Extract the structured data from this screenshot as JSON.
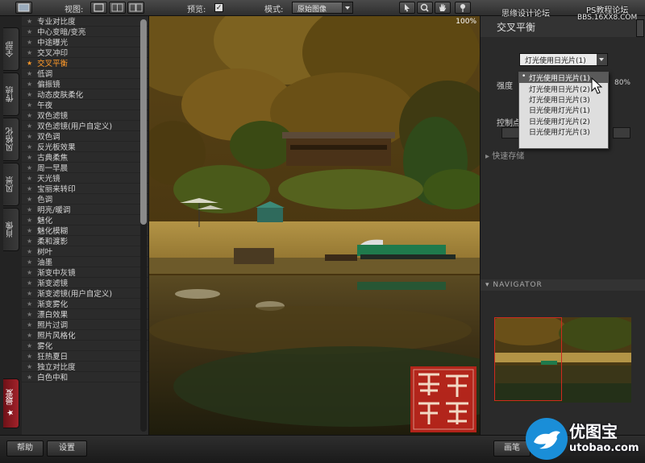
{
  "toolbar": {
    "view_label": "视图:",
    "preview_label": "预览:",
    "mode_label": "模式:",
    "mode_value": "原始图像"
  },
  "left_tabs": [
    "全部",
    "传统",
    "风格化",
    "风景",
    "肖像",
    "最爱"
  ],
  "filters": [
    "专业对比度",
    "中心变暗/变亮",
    "中途曝光",
    "交叉冲印",
    "交叉平衡",
    "低调",
    "偏振镜",
    "动态皮肤柔化",
    "午夜",
    "双色滤镜",
    "双色滤镜(用户自定义)",
    "双色调",
    "反光板效果",
    "古典柔焦",
    "周一早晨",
    "天光镜",
    "宝丽来转印",
    "色调",
    "明亮/暖调",
    "魅化",
    "魅化模糊",
    "柔和渡影",
    "树叶",
    "油墨",
    "渐变中灰镜",
    "渐变滤镜",
    "渐变滤镜(用户自定义)",
    "渐变雾化",
    "漂白效果",
    "照片过调",
    "照片风格化",
    "雾化",
    "狂热夏日",
    "独立对比度",
    "白色中和"
  ],
  "active_filter_index": 4,
  "photo": {
    "zoom": "100%"
  },
  "right_panel": {
    "title": "交叉平衡",
    "preset_value": "灯光使用日光片(1)",
    "strength_label": "强度",
    "strength_value": "80%",
    "control_label": "控制点",
    "quick_save_label": "快速存储",
    "navigator_label": "NAVIGATOR"
  },
  "dropdown": {
    "selected_index": 0,
    "options": [
      "灯光使用日光片(1)",
      "灯光使用日光片(2)",
      "灯光使用日光片(3)",
      "日光使用灯光片(1)",
      "日光使用灯光片(2)",
      "日光使用灯光片(3)"
    ]
  },
  "bottom": {
    "help_label": "帮助",
    "settings_label": "设置",
    "brush_label": "画笔"
  },
  "watermarks": {
    "site_cn": "思缘设计论坛",
    "ps_tutorial": "PS教程论坛",
    "ps_url": "BBS.16XX8.COM",
    "uto_name": "优图宝",
    "uto_url": "utobao.com"
  },
  "colors": {
    "accent_active": "#ff9a2a",
    "seal_red": "#c2251c",
    "uto_blue": "#1a8ed8"
  }
}
